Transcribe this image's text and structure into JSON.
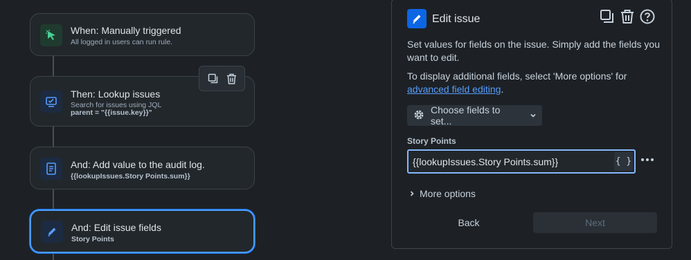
{
  "flow": {
    "trigger": {
      "title": "When: Manually triggered",
      "subtitle": "All logged in users can run rule."
    },
    "lookup": {
      "title": "Then: Lookup issues",
      "subtitle": "Search for issues using JQL",
      "jql": "parent = \"{{issue.key}}\""
    },
    "audit": {
      "title": "And: Add value to the audit log.",
      "value": "{{lookupIssues.Story Points.sum}}"
    },
    "edit": {
      "title": "And: Edit issue fields",
      "field": "Story Points"
    }
  },
  "panel": {
    "title": "Edit issue",
    "description": "Set values for fields on the issue. Simply add the fields you want to edit.",
    "additional_text": "To display additional fields, select 'More options' for",
    "advanced_link": "advanced field editing",
    "period": ".",
    "choose_fields_label": "Choose fields to set...",
    "field_label": "Story Points",
    "field_value": "{{lookupIssues.Story Points.sum}}",
    "smart_value_icon": "{ }",
    "more_options_label": "More options",
    "back_label": "Back",
    "next_label": "Next"
  },
  "colors": {
    "accent": "#4c9aff",
    "trigger_icon_bg": "#1f3a2e",
    "trigger_icon": "#4bce97",
    "action_icon_bg": "#1c2b41",
    "action_icon": "#579dff"
  }
}
